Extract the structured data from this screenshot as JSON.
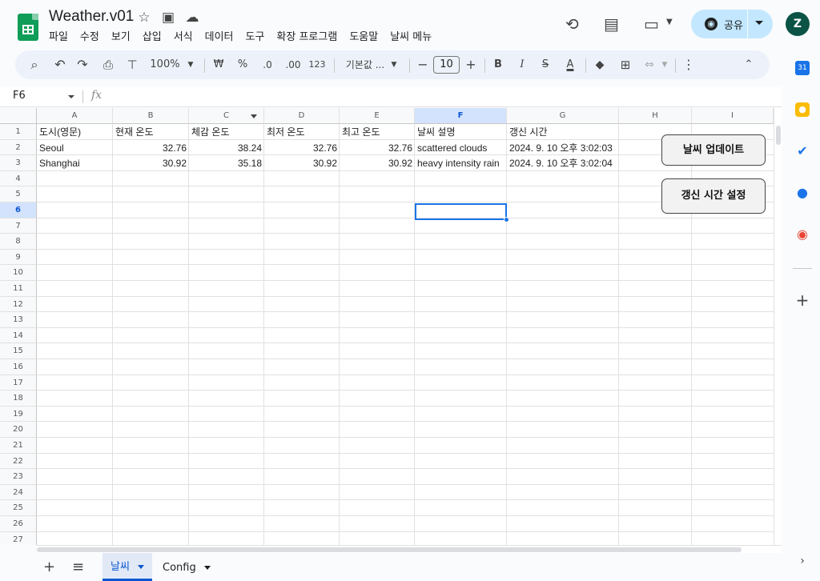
{
  "app": {
    "doc_title": "Weather.v01",
    "menus": [
      "파일",
      "수정",
      "보기",
      "삽입",
      "서식",
      "데이터",
      "도구",
      "확장 프로그램",
      "도움말",
      "날씨 메뉴"
    ],
    "share_label": "공유",
    "avatar_letter": "Z"
  },
  "toolbar": {
    "zoom": "100%",
    "currency": "₩",
    "percent": "%",
    "dec_decrease": ".0",
    "dec_increase": ".00",
    "number_format": "123",
    "font_name": "기본값 ...",
    "font_size": "10",
    "bold": "B",
    "italic": "I",
    "strike": "S",
    "text_color": "A"
  },
  "formula_bar": {
    "cell_ref": "F6",
    "fx": "fx",
    "value": ""
  },
  "grid": {
    "columns": [
      "A",
      "B",
      "C",
      "D",
      "E",
      "F",
      "G",
      "H",
      "I"
    ],
    "selected_column": "F",
    "rows": [
      "1",
      "2",
      "3",
      "4",
      "5",
      "6",
      "7",
      "8",
      "9",
      "10",
      "11",
      "12",
      "13",
      "14",
      "15",
      "16",
      "17",
      "18",
      "19",
      "20",
      "21",
      "22",
      "23",
      "24",
      "25",
      "26",
      "27"
    ],
    "selected_row": "6",
    "header": [
      "도시(영문)",
      "현재 온도",
      "체감 온도",
      "최저 온도",
      "최고 온도",
      "날씨 설명",
      "갱신 시간"
    ],
    "data": [
      [
        "Seoul",
        "32.76",
        "38.24",
        "32.76",
        "32.76",
        "scattered clouds",
        "2024. 9. 10 오후 3:02:03"
      ],
      [
        "Shanghai",
        "30.92",
        "35.18",
        "30.92",
        "30.92",
        "heavy intensity rain",
        "2024. 9. 10 오후 3:02:04"
      ]
    ]
  },
  "drawings": {
    "update_weather": "날씨 업데이트",
    "set_refresh_time": "갱신 시간 설정"
  },
  "sheets": {
    "tabs": [
      "날씨",
      "Config"
    ],
    "active": "날씨"
  },
  "colors": {
    "accent": "#0b57d0",
    "selection": "#1a73e8",
    "sheets_green": "#0f9d58",
    "share_bg": "#c2e7ff"
  }
}
